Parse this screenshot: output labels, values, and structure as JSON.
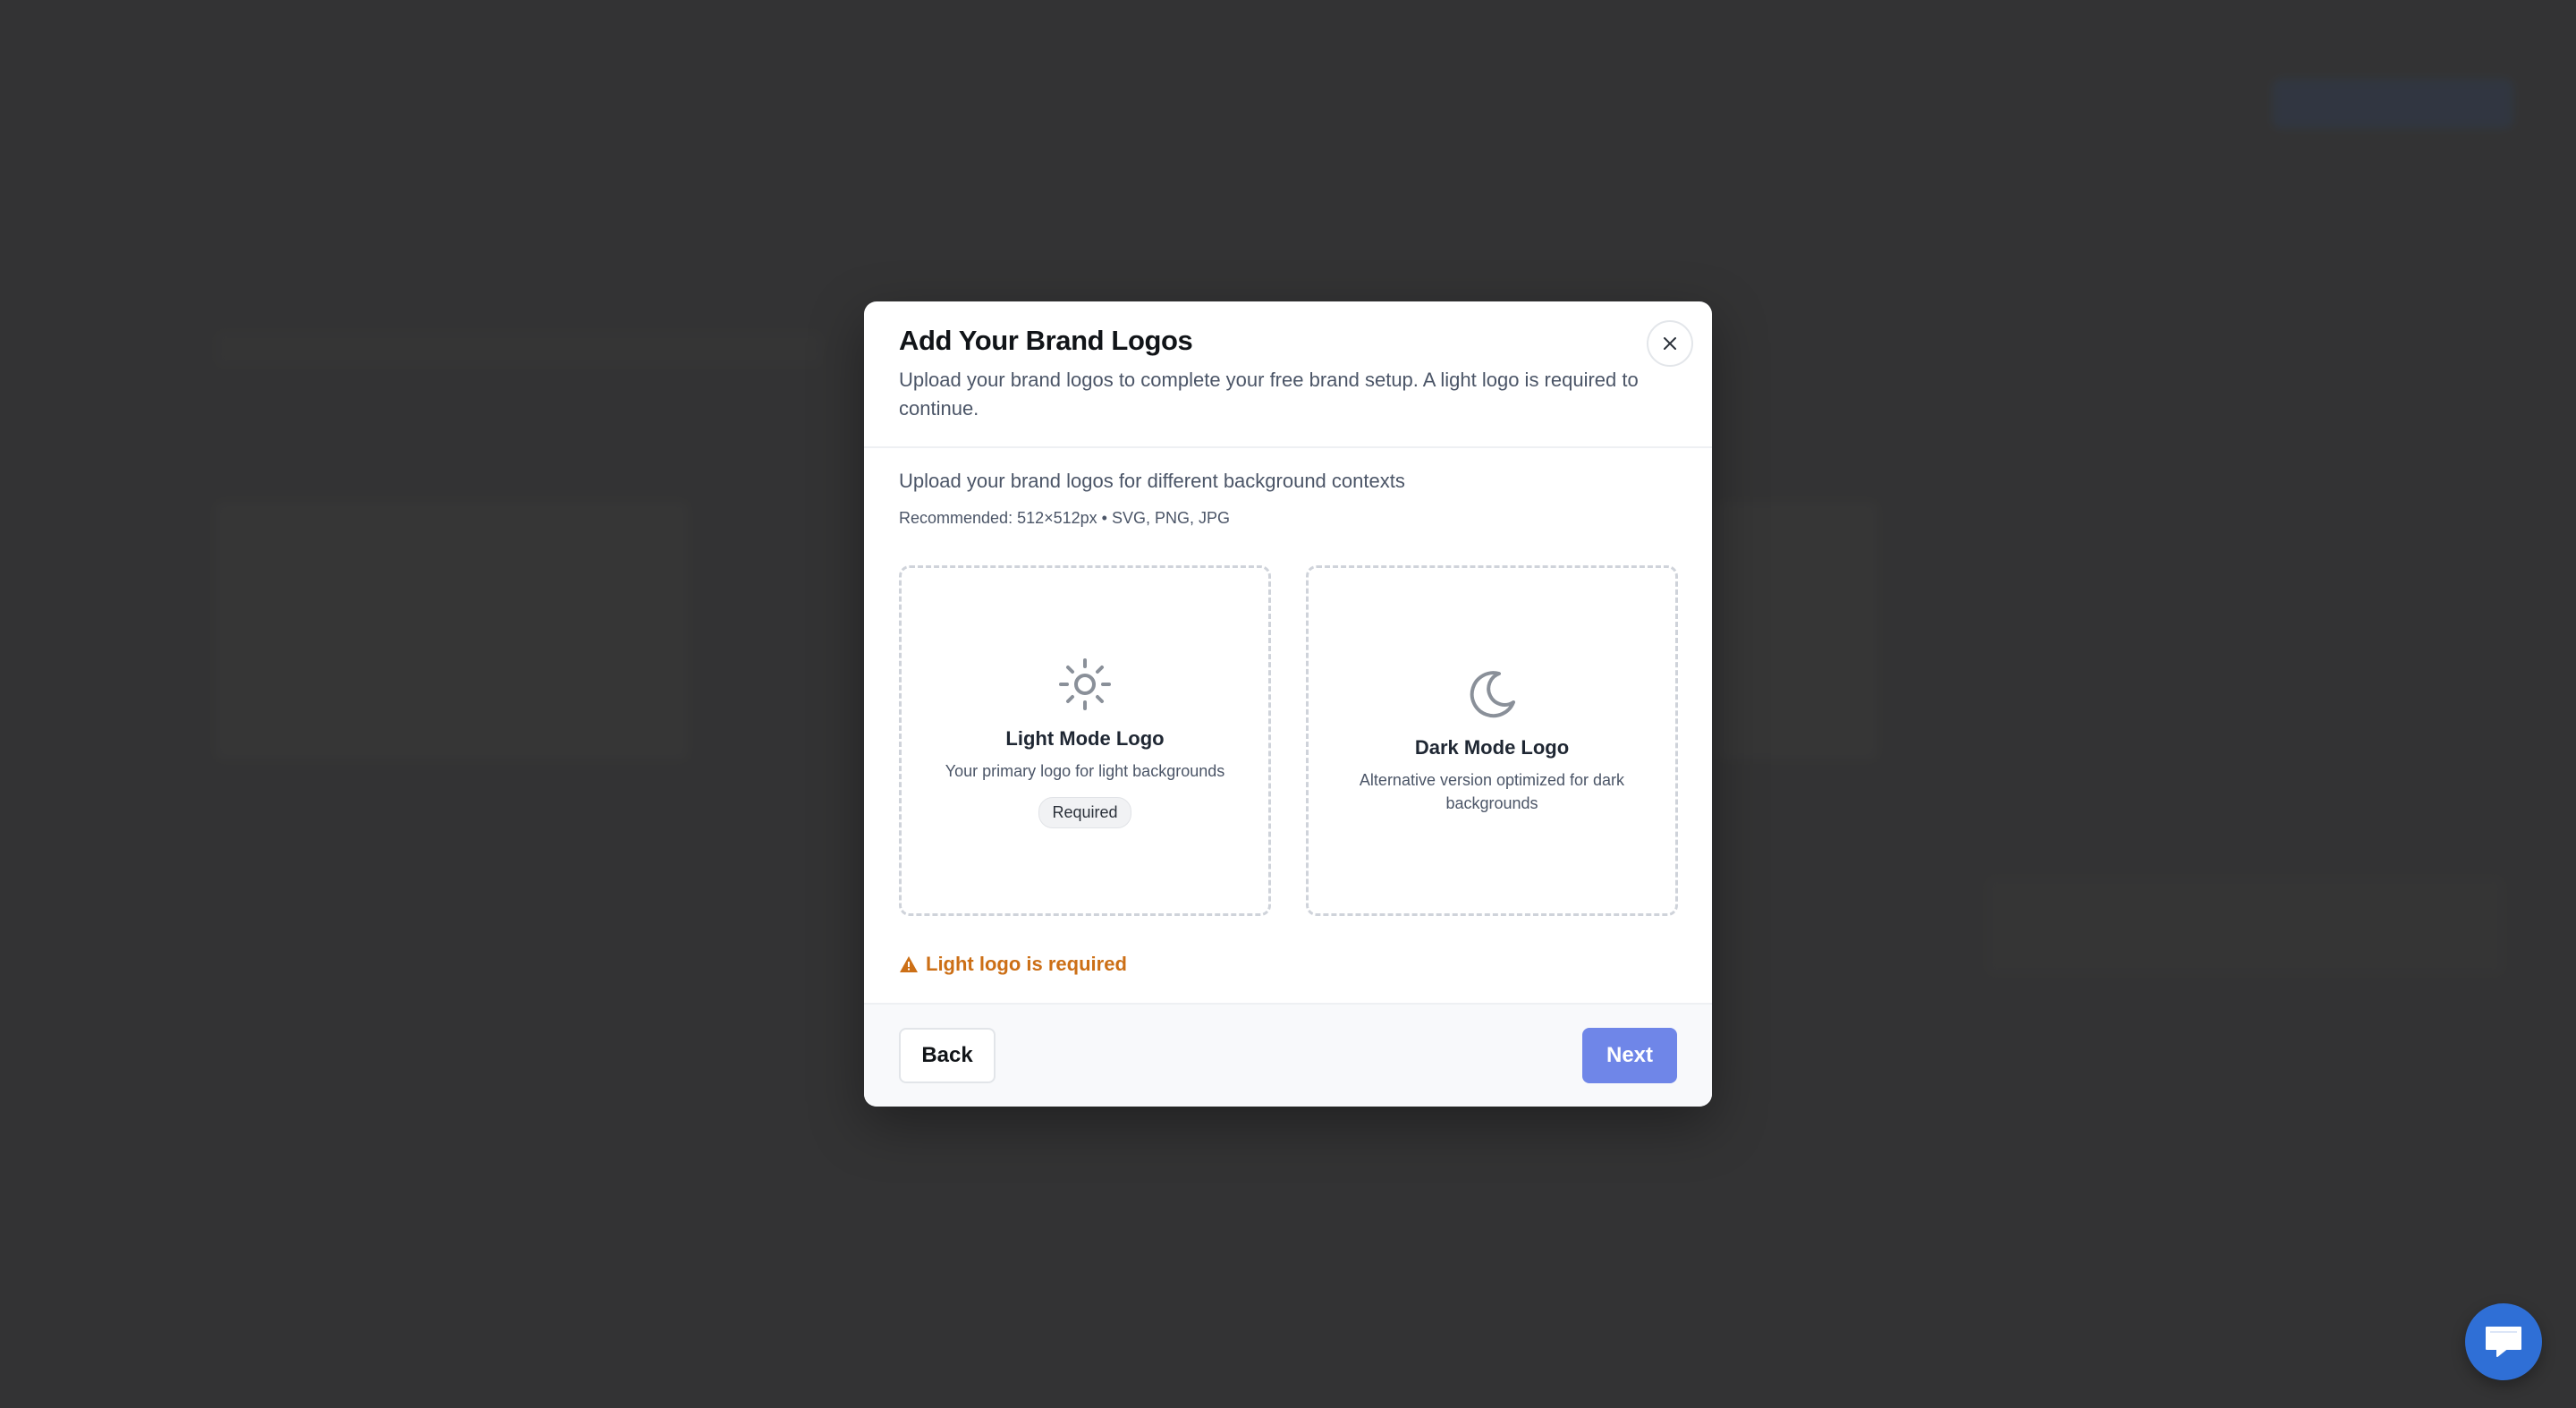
{
  "modal": {
    "title": "Add Your Brand Logos",
    "subtitle": "Upload your brand logos to complete your free brand setup. A light logo is required to continue.",
    "close_icon": "close-icon"
  },
  "body": {
    "intro": "Upload your brand logos for different background contexts",
    "recommendation": "Recommended: 512×512px • SVG, PNG, JPG"
  },
  "cards": {
    "light": {
      "icon": "sun-icon",
      "title": "Light Mode Logo",
      "description": "Your primary logo for light backgrounds",
      "badge": "Required"
    },
    "dark": {
      "icon": "moon-icon",
      "title": "Dark Mode Logo",
      "description": "Alternative version optimized for dark backgrounds"
    }
  },
  "error": {
    "icon": "warning-icon",
    "text": "Light logo is required",
    "color": "#cc6f16"
  },
  "footer": {
    "back_label": "Back",
    "next_label": "Next"
  },
  "chat": {
    "icon": "chat-icon"
  },
  "colors": {
    "accent": "#6f86e8",
    "chat": "#2f6fd6",
    "backdrop": "#3b3b3c"
  }
}
